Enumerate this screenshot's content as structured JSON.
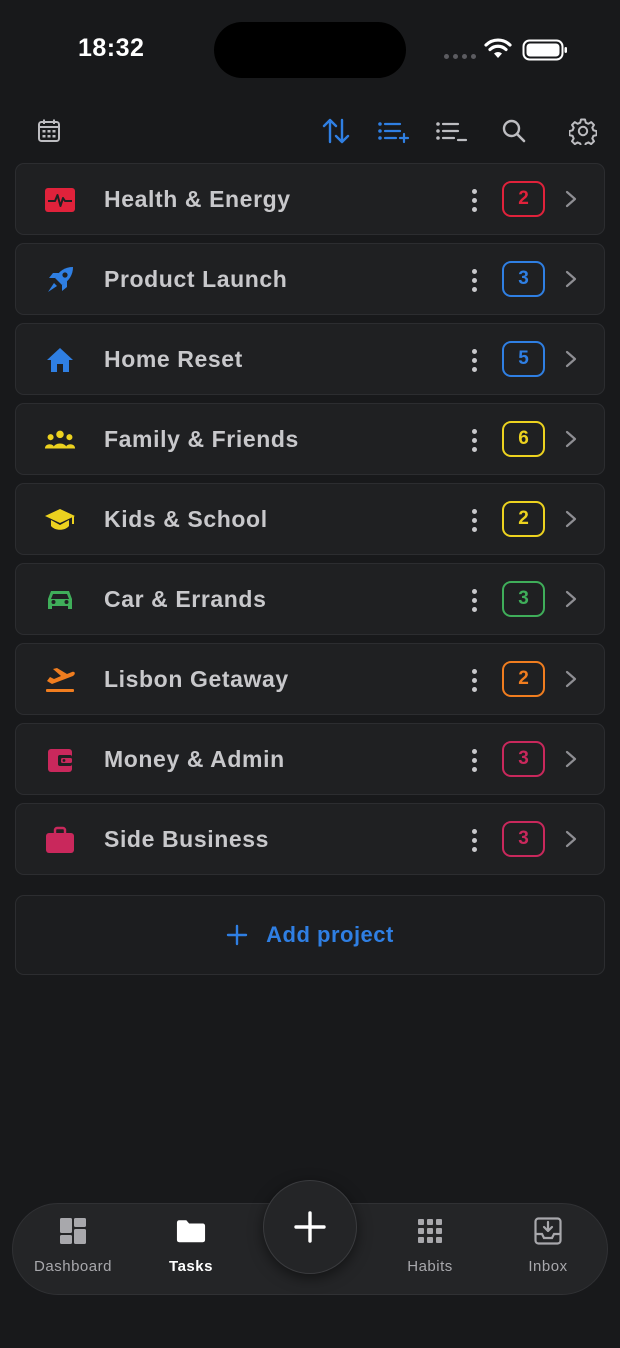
{
  "status_bar": {
    "time": "18:32"
  },
  "toolbar": {
    "icons": [
      "calendar-icon",
      "sort-icon",
      "expand-list-icon",
      "collapse-list-icon",
      "search-icon",
      "settings-icon"
    ],
    "accent_color": "#2f7fe3"
  },
  "projects": [
    {
      "name": "Health & Energy",
      "count": "2",
      "icon": "heart-pulse-icon",
      "color": "#e0223b"
    },
    {
      "name": "Product Launch",
      "count": "3",
      "icon": "rocket-icon",
      "color": "#2f7fe3"
    },
    {
      "name": "Home Reset",
      "count": "5",
      "icon": "home-icon",
      "color": "#2f7fe3"
    },
    {
      "name": "Family & Friends",
      "count": "6",
      "icon": "people-icon",
      "color": "#ecd21f"
    },
    {
      "name": "Kids & School",
      "count": "2",
      "icon": "graduation-cap-icon",
      "color": "#ecd21f"
    },
    {
      "name": "Car & Errands",
      "count": "3",
      "icon": "car-icon",
      "color": "#3fae5a"
    },
    {
      "name": "Lisbon Getaway",
      "count": "2",
      "icon": "plane-takeoff-icon",
      "color": "#f07d1f"
    },
    {
      "name": "Money & Admin",
      "count": "3",
      "icon": "wallet-icon",
      "color": "#c9285c"
    },
    {
      "name": "Side Business",
      "count": "3",
      "icon": "briefcase-icon",
      "color": "#c9285c"
    }
  ],
  "add_project": {
    "label": "Add project"
  },
  "nav": {
    "tabs": [
      {
        "label": "Dashboard",
        "icon": "dashboard-icon",
        "active": false
      },
      {
        "label": "Tasks",
        "icon": "folder-icon",
        "active": true
      },
      {
        "label": "Habits",
        "icon": "grid-icon",
        "active": false
      },
      {
        "label": "Inbox",
        "icon": "inbox-icon",
        "active": false
      }
    ],
    "fab_icon": "plus-icon"
  }
}
